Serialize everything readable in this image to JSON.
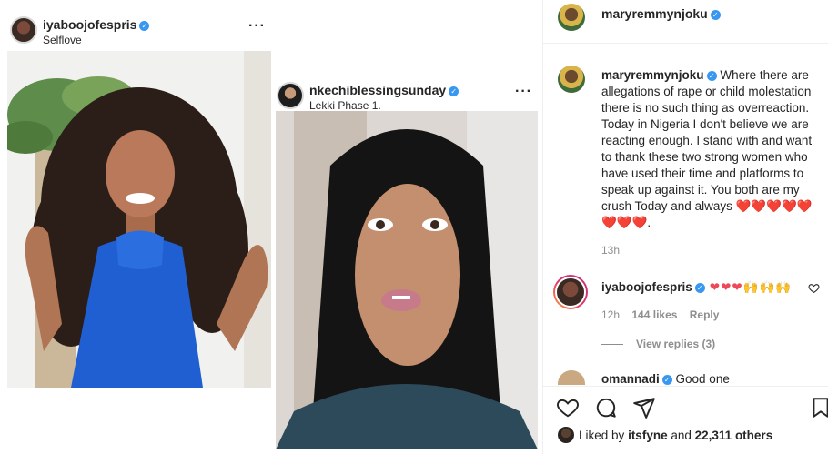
{
  "left_posts": [
    {
      "username": "iyaboojofespris",
      "location": "Selflove",
      "more_icon": "more-horizontal-icon"
    },
    {
      "username": "nkechiblessingsunday",
      "location": "Lekki Phase 1.",
      "more_icon": "more-horizontal-icon"
    }
  ],
  "post": {
    "header_username": "maryremmynjoku",
    "caption_username": "maryremmynjoku",
    "caption_text": "Where there are allegations of rape or child molestation there is no such thing as overreaction. Today in Nigeria I don't believe we are reacting enough. I stand with and want to thank these two strong women who have used their time and platforms to speak up against it. You both are my crush Today and always ❤️❤️❤️❤️❤️❤️❤️❤️.",
    "caption_time": "13h",
    "comment": {
      "username": "iyaboojofespris",
      "emoji": "❤❤❤🙌🙌🙌",
      "time": "12h",
      "likes": "144 likes",
      "reply": "Reply"
    },
    "view_replies": "View replies (3)",
    "next_comment": {
      "username": "omannadi",
      "text": "Good one"
    },
    "liked_by_prefix": "Liked by",
    "liked_by_user": "itsfyne",
    "liked_by_and": "and",
    "liked_by_others": "22,311 others"
  },
  "colors": {
    "verified": "#3897f0",
    "heart": "#ed4956",
    "muted": "#8e8e8e",
    "dress_blue": "#1f5fd1"
  }
}
